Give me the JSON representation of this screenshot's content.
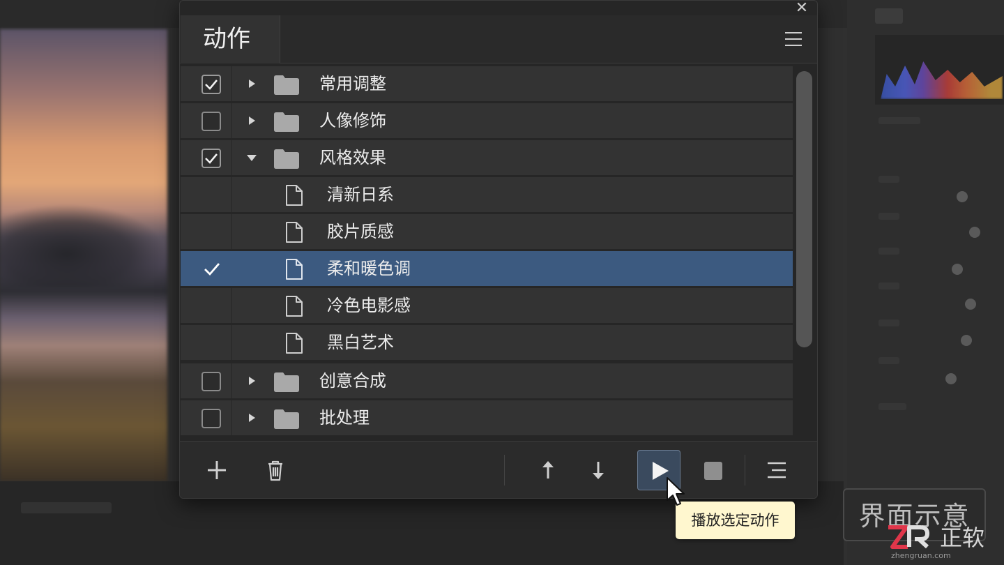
{
  "panel": {
    "tab_title": "动作",
    "close_glyph": "✕"
  },
  "actions": [
    {
      "label": "常用调整",
      "kind": "folder",
      "checked": true,
      "expanded": false
    },
    {
      "label": "人像修饰",
      "kind": "folder",
      "checked": false,
      "expanded": false
    },
    {
      "label": "风格效果",
      "kind": "folder",
      "checked": true,
      "expanded": true
    },
    {
      "label": "清新日系",
      "kind": "action",
      "checked": false
    },
    {
      "label": "胶片质感",
      "kind": "action",
      "checked": false
    },
    {
      "label": "柔和暖色调",
      "kind": "action",
      "checked": true,
      "selected": true
    },
    {
      "label": "冷色电影感",
      "kind": "action",
      "checked": false
    },
    {
      "label": "黑白艺术",
      "kind": "action",
      "checked": false
    },
    {
      "label": "创意合成",
      "kind": "folder",
      "checked": false,
      "expanded": false
    },
    {
      "label": "批处理",
      "kind": "folder",
      "checked": false,
      "expanded": false
    }
  ],
  "footer": {
    "buttons": [
      "add-icon",
      "trash-icon",
      "arrow-up-icon",
      "arrow-down-icon",
      "play-icon",
      "stop-icon",
      "list-icon"
    ]
  },
  "tooltip": {
    "text": "播放选定动作"
  },
  "watermark": {
    "box_text": "界面示意",
    "logo_text": "正软",
    "logo_url": "zhengruan.com"
  },
  "colors": {
    "selected_row": "#3c5a80",
    "panel_bg": "#262626",
    "row_bg": "#333333",
    "tooltip_bg": "#fff7cf",
    "logo_red": "#e0364a"
  }
}
